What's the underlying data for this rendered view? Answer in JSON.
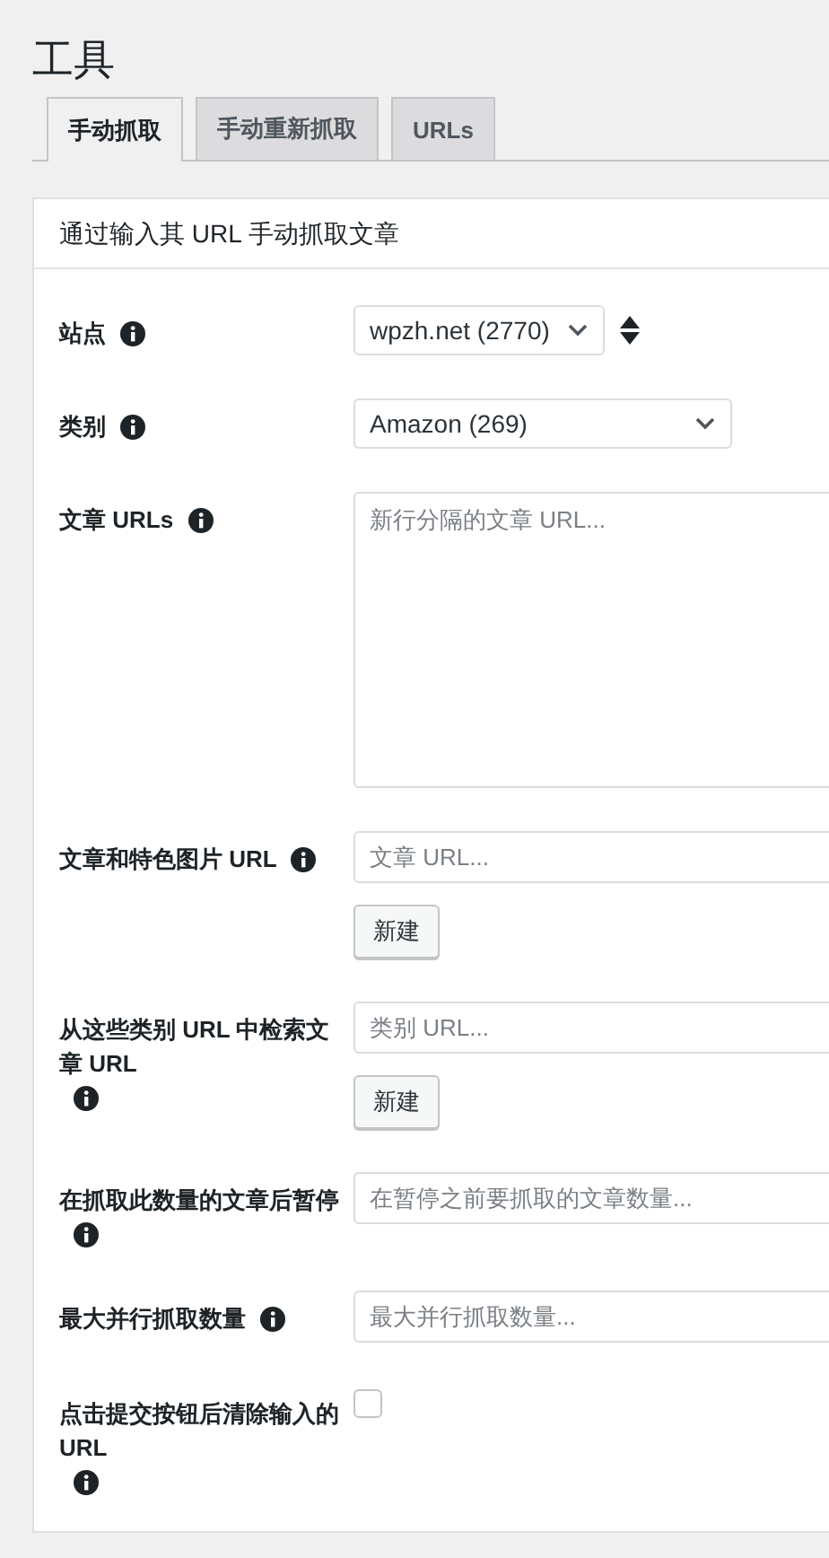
{
  "page_title": "工具",
  "tabs": [
    {
      "label": "手动抓取",
      "selected": true
    },
    {
      "label": "手动重新抓取",
      "selected": false
    },
    {
      "label": "URLs",
      "selected": false
    }
  ],
  "panel": {
    "title": "通过输入其 URL 手动抓取文章",
    "rows": [
      {
        "kind": "select",
        "label": "站点",
        "value": "wpzh.net (2770)",
        "sort_handle": true
      },
      {
        "kind": "select",
        "label": "类别",
        "value": "Amazon (269)",
        "sort_handle": false
      },
      {
        "kind": "textarea",
        "label": "文章 URLs",
        "placeholder": "新行分隔的文章 URL..."
      },
      {
        "kind": "input",
        "label": "文章和特色图片 URL",
        "placeholder": "文章 URL...",
        "button": "新建"
      },
      {
        "kind": "input",
        "label": "从这些类别 URL 中检索文章 URL",
        "placeholder": "类别 URL...",
        "button": "新建"
      },
      {
        "kind": "input",
        "label": "在抓取此数量的文章后暂停",
        "placeholder": "在暂停之前要抓取的文章数量..."
      },
      {
        "kind": "input",
        "label": "最大并行抓取数量",
        "placeholder": "最大并行抓取数量..."
      },
      {
        "kind": "checkbox",
        "label": "点击提交按钮后清除输入的 URL",
        "checked": false
      }
    ]
  }
}
